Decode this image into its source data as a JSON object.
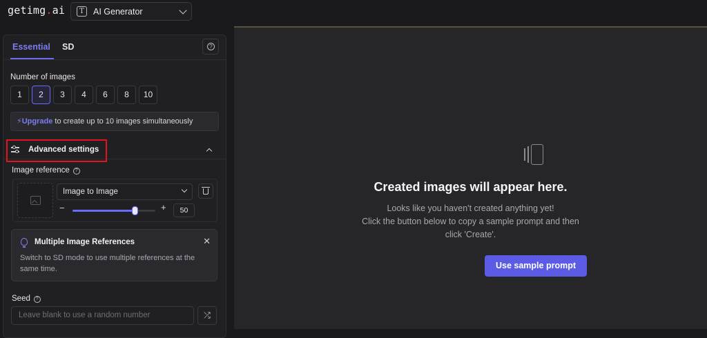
{
  "app": {
    "logo_text": "getimg",
    "logo_dot": ".",
    "logo_suffix": "ai",
    "generator_select": "AI Generator",
    "generator_icon": "T"
  },
  "sidebar": {
    "tabs": [
      {
        "label": "Essential",
        "active": true
      },
      {
        "label": "SD",
        "active": false
      }
    ],
    "number_of_images": {
      "label": "Number of images",
      "options": [
        "1",
        "2",
        "3",
        "4",
        "6",
        "8",
        "10"
      ],
      "selected": "2"
    },
    "upgrade": {
      "link": "Upgrade",
      "text": " to create up to 10 images simultaneously"
    },
    "advanced": {
      "label": "Advanced settings"
    },
    "image_reference": {
      "label": "Image reference",
      "mode": "Image to Image",
      "strength": "50",
      "strength_fraction": 0.5
    },
    "tip": {
      "title": "Multiple Image References",
      "body": "Switch to SD mode to use multiple references at the same time."
    },
    "seed": {
      "label": "Seed",
      "placeholder": "Leave blank to use a random number"
    }
  },
  "main": {
    "title": "Created images will appear here.",
    "subtitle_lines": [
      "Looks like you haven't created anything yet!",
      "Click the button below to copy a sample prompt and then",
      "click 'Create'."
    ],
    "cta": "Use sample prompt"
  },
  "colors": {
    "accent": "#6b6bf5",
    "highlight_box": "#e0161c",
    "background": "#1a1a1c"
  }
}
